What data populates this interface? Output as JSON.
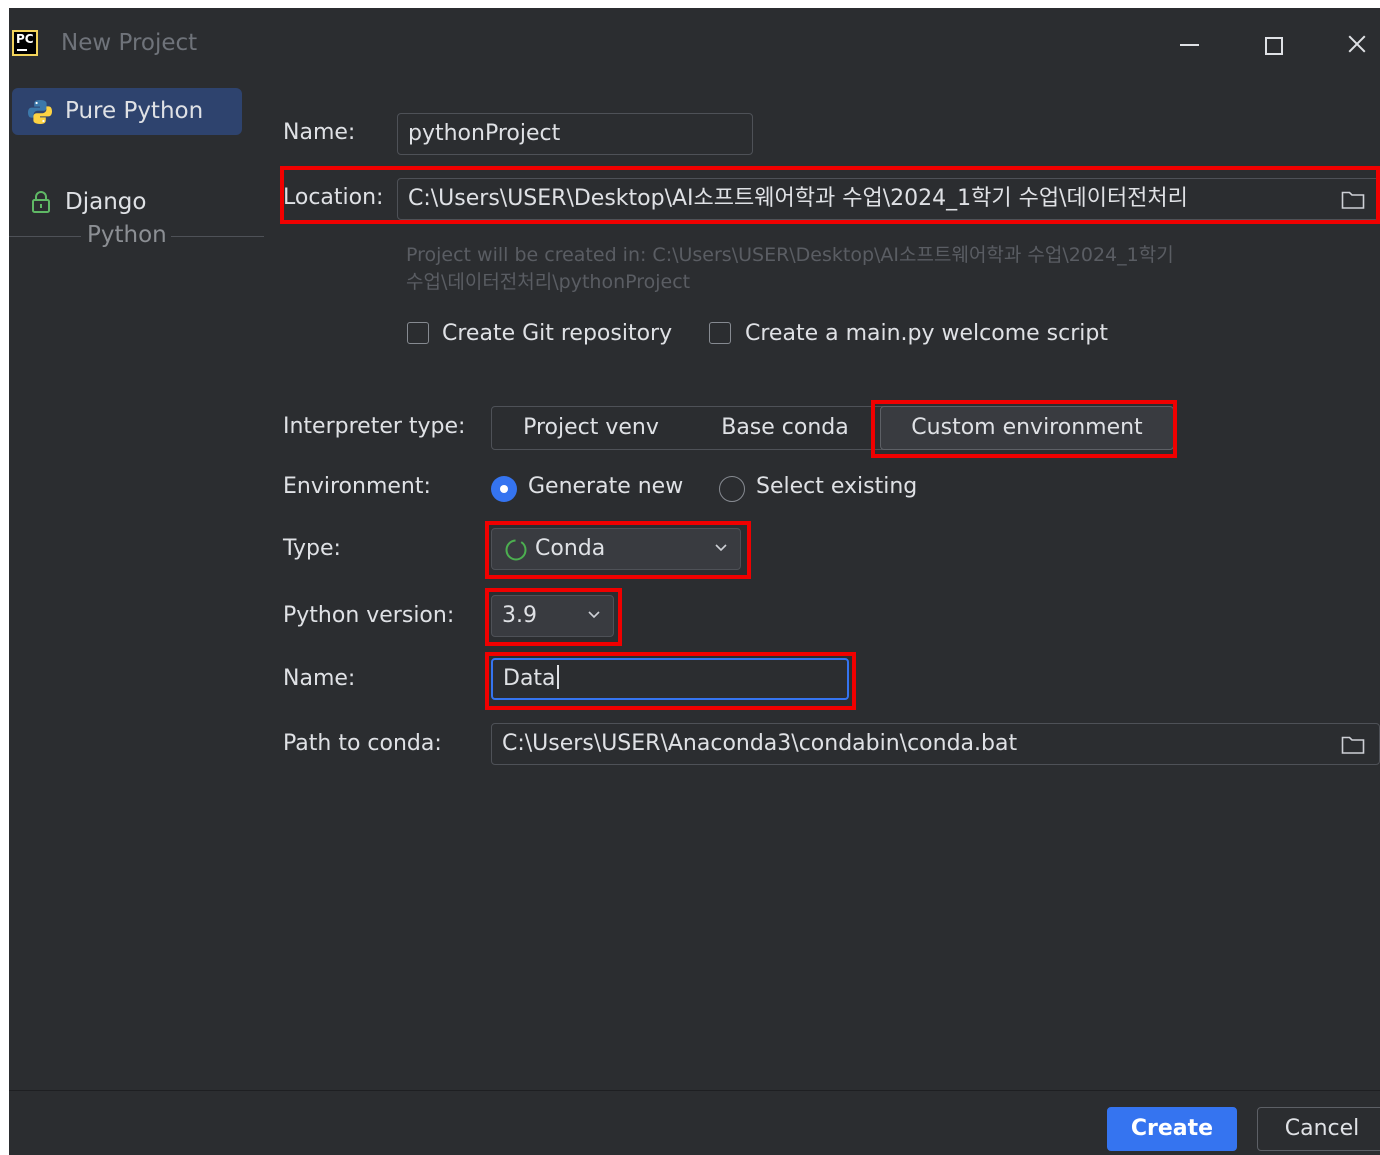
{
  "window": {
    "title": "New Project",
    "app_icon_text": "PC"
  },
  "sidebar": {
    "items": [
      {
        "label": "Pure Python",
        "icon": "python-icon",
        "selected": true
      },
      {
        "label": "Django",
        "icon": "lock-icon",
        "selected": false
      }
    ],
    "group_label": "Python"
  },
  "form": {
    "name_label": "Name:",
    "name_value": "pythonProject",
    "location_label": "Location:",
    "location_value": "C:\\Users\\USER\\Desktop\\AI소프트웨어학과 수업\\2024_1학기 수업\\데이터전처리",
    "hint_line1": "Project will be created in: C:\\Users\\USER\\Desktop\\AI소프트웨어학과 수업\\2024_1학기",
    "hint_line2": "수업\\데이터전처리\\pythonProject",
    "create_git_label": "Create Git repository",
    "create_main_label": "Create a main.py welcome script",
    "interpreter_type_label": "Interpreter type:",
    "interpreter_options": [
      "Project venv",
      "Base conda",
      "Custom environment"
    ],
    "interpreter_selected": "Custom environment",
    "environment_label": "Environment:",
    "env_generate_new": "Generate new",
    "env_select_existing": "Select existing",
    "type_label": "Type:",
    "type_value": "Conda",
    "python_version_label": "Python version:",
    "python_version_value": "3.9",
    "env_name_label": "Name:",
    "env_name_value": "Data",
    "path_to_conda_label": "Path to conda:",
    "path_to_conda_value": "C:\\Users\\USER\\Anaconda3\\condabin\\conda.bat"
  },
  "footer": {
    "create_label": "Create",
    "cancel_label": "Cancel"
  },
  "colors": {
    "accent": "#3574f0",
    "highlight": "#f00000",
    "background": "#2b2d30"
  }
}
